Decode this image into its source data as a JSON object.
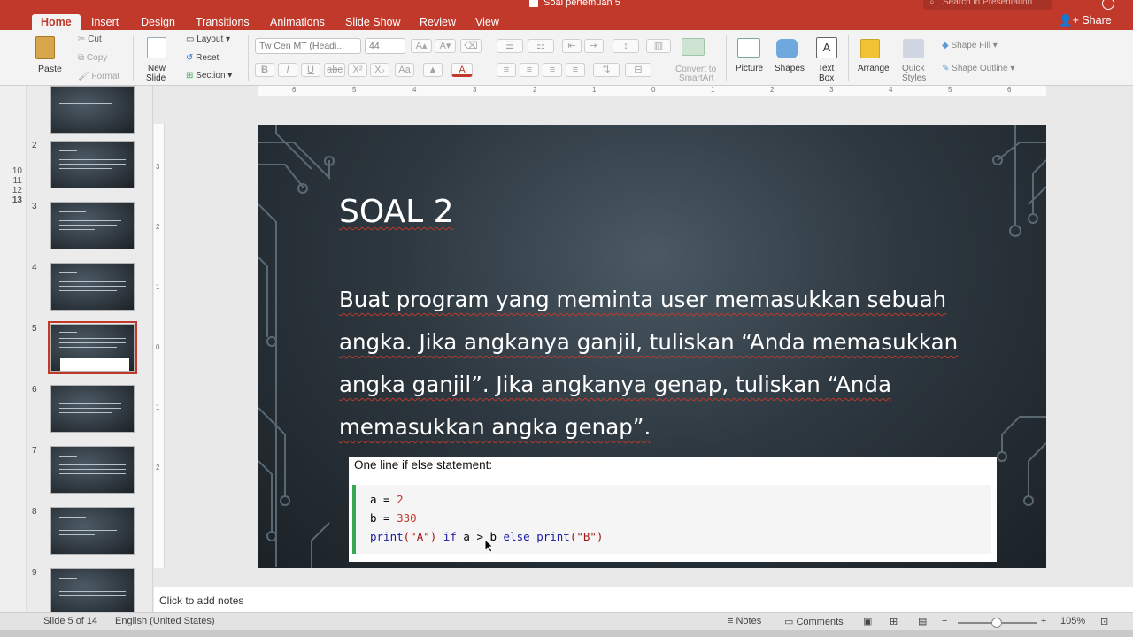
{
  "window": {
    "title": "Soal pertemuan 5",
    "search_placeholder": "Search in Presentation"
  },
  "tabs": [
    "Home",
    "Insert",
    "Design",
    "Transitions",
    "Animations",
    "Slide Show",
    "Review",
    "View"
  ],
  "share_label": "Share",
  "ribbon": {
    "paste": "Paste",
    "cut": "Cut",
    "copy": "Copy",
    "format": "Format",
    "new_slide": "New",
    "new_slide2": "Slide",
    "layout": "Layout",
    "reset": "Reset",
    "section": "Section",
    "font_name": "Tw Cen MT (Headi...",
    "font_size": "44",
    "bold": "B",
    "italic": "I",
    "underline": "U",
    "strike": "abc",
    "superscript": "X²",
    "subscript": "X₂",
    "text_color": "A",
    "convert1": "Convert to",
    "convert2": "SmartArt",
    "picture": "Picture",
    "shapes": "Shapes",
    "textbox1": "Text",
    "textbox2": "Box",
    "arrange": "Arrange",
    "quick1": "Quick",
    "quick2": "Styles",
    "shape_fill": "Shape Fill",
    "shape_outline": "Shape Outline"
  },
  "ruler_h": [
    "6",
    "5",
    "4",
    "3",
    "2",
    "1",
    "0",
    "1",
    "2",
    "3",
    "4",
    "5",
    "6"
  ],
  "ruler_v": [
    "3",
    "2",
    "1",
    "0",
    "1",
    "2"
  ],
  "gutter_numbers": [
    "9",
    "10",
    "11",
    "12",
    "13"
  ],
  "thumbnails": [
    {
      "num": "",
      "title": "LATIHAN DASAR-DASAR PYTHON"
    },
    {
      "num": "2",
      "title": "SOAL 1"
    },
    {
      "num": "3",
      "title": "IDE ALGORITMA"
    },
    {
      "num": "4",
      "title": "SOAL 2"
    },
    {
      "num": "5",
      "title": "SOAL 2"
    },
    {
      "num": "6",
      "title": "IDE ALGORITMA"
    },
    {
      "num": "7",
      "title": "SOAL 3"
    },
    {
      "num": "8",
      "title": "IDE ALGORITMA"
    },
    {
      "num": "9",
      "title": "SOAL 4"
    }
  ],
  "slide": {
    "title": "SOAL 2",
    "body": "Buat program yang meminta user memasukkan sebuah angka. Jika angkanya ganjil, tuliskan “Anda memasukkan angka ganjil”. Jika angkanya genap, tuliskan “Anda memasukkan angka genap”.",
    "code_heading": "One line if else statement:",
    "code": {
      "line1_var": "a = ",
      "line1_val": "2",
      "line2_var": "b = ",
      "line2_val": "330",
      "line3_p1": "print",
      "line3_s1": "(\"A\")",
      "line3_if": " if ",
      "line3_mid": "a > b ",
      "line3_else": "else ",
      "line3_p2": "print",
      "line3_s2": "(\"B\")"
    }
  },
  "notes_placeholder": "Click to add notes",
  "status": {
    "slide": "Slide 5 of 14",
    "language": "English (United States)",
    "notes": "Notes",
    "comments": "Comments",
    "zoom": "105%"
  },
  "colors": {
    "accent": "#c0392b",
    "code_bar": "#3aa757"
  }
}
